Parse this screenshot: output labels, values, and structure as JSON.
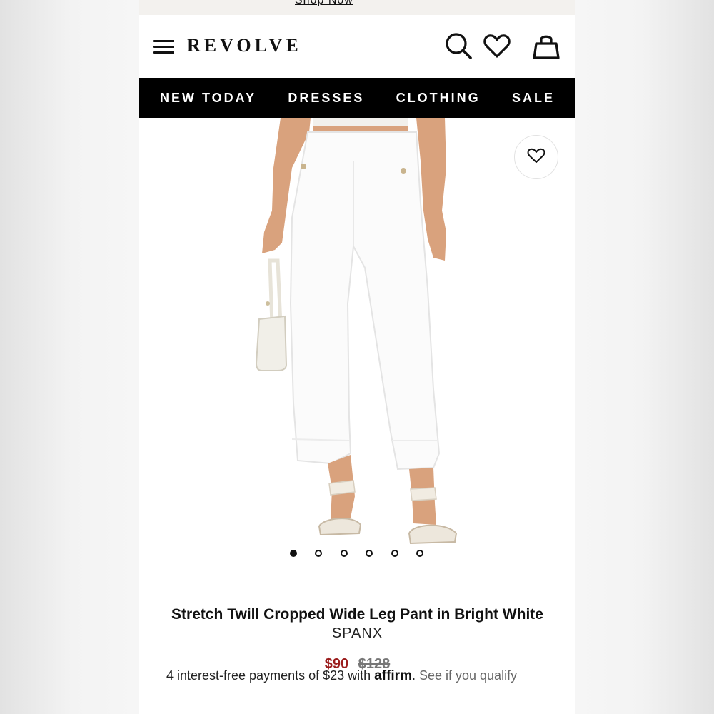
{
  "promo": {
    "link_label": "Shop Now"
  },
  "header": {
    "logo": "REVOLVE",
    "icons": [
      "menu-icon",
      "search-icon",
      "heart-icon",
      "bag-icon"
    ]
  },
  "nav": {
    "items": [
      {
        "label": "NEW TODAY"
      },
      {
        "label": "DRESSES"
      },
      {
        "label": "CLOTHING"
      },
      {
        "label": "SALE"
      }
    ]
  },
  "product": {
    "title": "Stretch Twill Cropped Wide Leg Pant in Bright White",
    "brand": "SPANX",
    "sale_price": "$90",
    "original_price": "$128",
    "image_count": 6,
    "active_image": 1,
    "sale_color": "#9b1c1c",
    "affirm": {
      "text": "4 interest-free payments of $23 with",
      "mark": "affirm",
      "link": "See if you qualify"
    }
  },
  "colors": {
    "nav_bg": "#000000",
    "page_bg": "#ffffff",
    "sale": "#9b1c1c"
  }
}
